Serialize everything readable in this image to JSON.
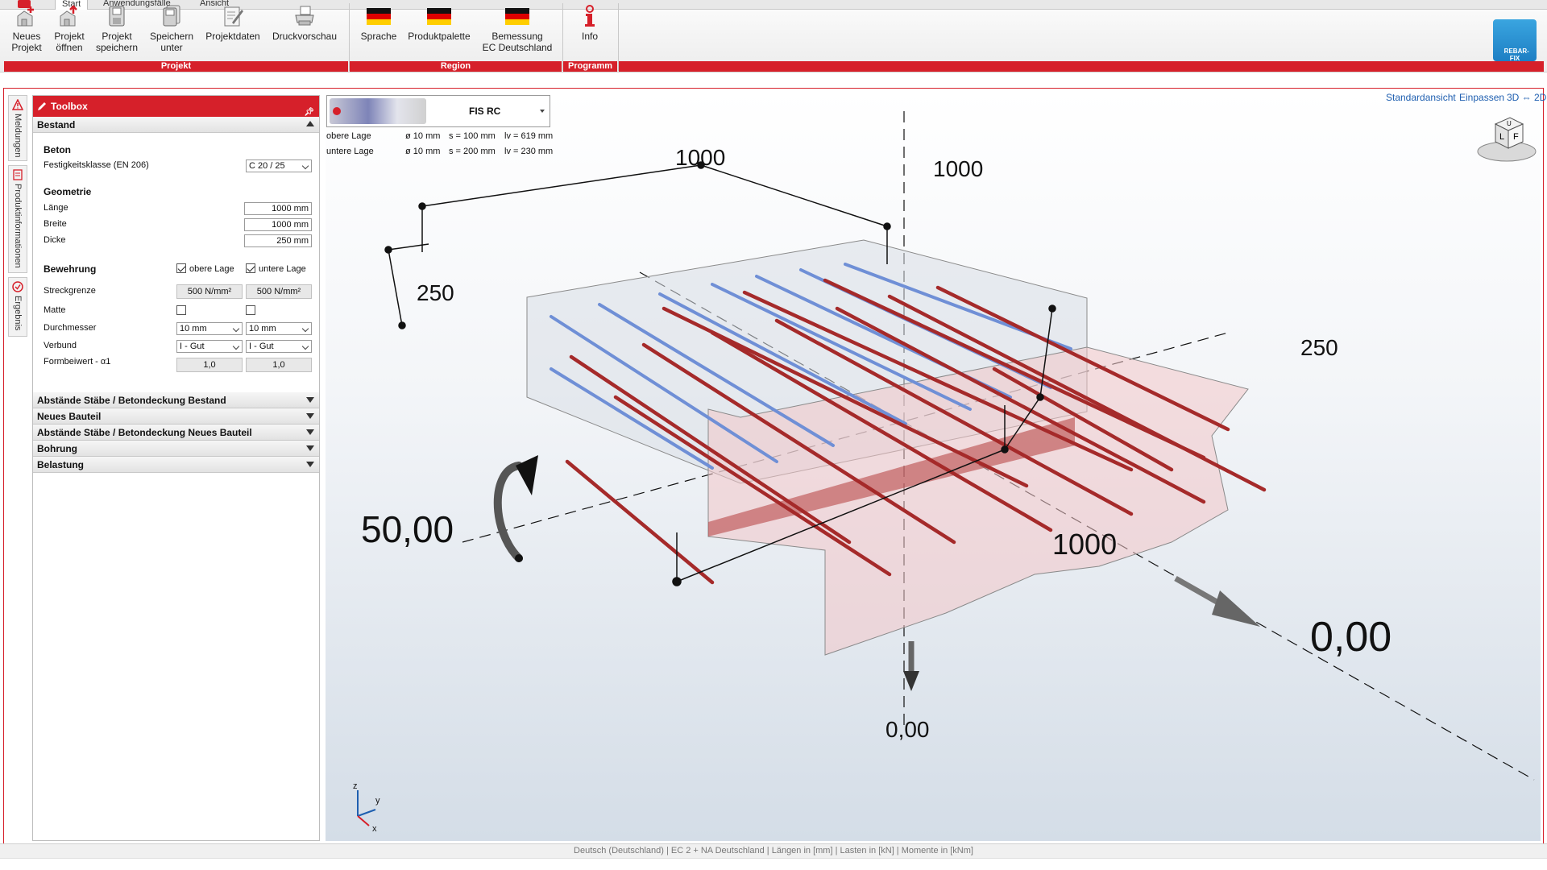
{
  "tabs": {
    "start": "Start",
    "anwendung": "Anwendungsfälle",
    "ansicht": "Ansicht"
  },
  "ribbon": {
    "neues_projekt": "Neues\nProjekt",
    "projekt_oeffnen": "Projekt\nöffnen",
    "projekt_speichern": "Projekt\nspeichern",
    "speichern_unter": "Speichern\nunter",
    "projektdaten": "Projektdaten",
    "druckvorschau": "Druckvorschau",
    "sprache": "Sprache",
    "produktpalette": "Produktpalette",
    "bemessung": "Bemessung\nEC Deutschland",
    "info": "Info",
    "group_projekt": "Projekt",
    "group_region": "Region",
    "group_programm": "Programm",
    "logo_text": "REBAR-\nFIX"
  },
  "sidebar": {
    "meldungen": "Meldungen",
    "produktinfo": "Produktinformationen",
    "ergebnis": "Ergebnis"
  },
  "toolbox": {
    "title": "Toolbox",
    "bestand": "Bestand",
    "beton": "Beton",
    "festigkeit_label": "Festigkeitsklasse (EN 206)",
    "festigkeit_value": "C 20 / 25",
    "geometrie": "Geometrie",
    "laenge_label": "Länge",
    "laenge_value": "1000 mm",
    "breite_label": "Breite",
    "breite_value": "1000 mm",
    "dicke_label": "Dicke",
    "dicke_value": "250 mm",
    "bewehrung": "Bewehrung",
    "obere_lage": "obere Lage",
    "untere_lage": "untere Lage",
    "streckgrenze_label": "Streckgrenze",
    "streckgrenze_oben": "500 N/mm²",
    "streckgrenze_unten": "500 N/mm²",
    "matte_label": "Matte",
    "durchmesser_label": "Durchmesser",
    "durchmesser_oben": "10 mm",
    "durchmesser_unten": "10 mm",
    "verbund_label": "Verbund",
    "verbund_oben": "I - Gut",
    "verbund_unten": "I - Gut",
    "formbeiwert_label": "Formbeiwert - α1",
    "formbeiwert_oben": "1,0",
    "formbeiwert_unten": "1,0",
    "sections": [
      "Abstände Stäbe / Betondeckung Bestand",
      "Neues Bauteil",
      "Abstände Stäbe / Betondeckung Neues Bauteil",
      "Bohrung",
      "Belastung"
    ]
  },
  "product": {
    "name": "FIS RC",
    "obere": {
      "label": "obere Lage",
      "d": "ø 10 mm",
      "s": "s = 100 mm",
      "lv": "lv = 619 mm"
    },
    "untere": {
      "label": "untere Lage",
      "d": "ø 10 mm",
      "s": "s = 200 mm",
      "lv": "lv = 230 mm"
    }
  },
  "view": {
    "standard": "Standardansicht",
    "einpassen": "Einpassen",
    "toggle": "3D ⇔ 2D"
  },
  "navcube": {
    "top": "U",
    "left": "L",
    "right": "F"
  },
  "scene": {
    "dim_top_left": "1000",
    "dim_top_right": "1000",
    "dim_left_height": "250",
    "dim_right_height": "250",
    "dim_front": "1000",
    "moment_value": "50,00",
    "force_x_value": "0,00",
    "force_z_value": "0,00",
    "axis_z": "z",
    "axis_y": "y",
    "axis_x": "x"
  },
  "status": "Deutsch (Deutschland) | EC 2 + NA Deutschland | Längen in [mm] | Lasten in [kN] | Momente in [kNm]",
  "colors": {
    "accent": "#d6202a",
    "rebar_new": "#a52a2a",
    "rebar_existing": "#6f8fd6"
  }
}
